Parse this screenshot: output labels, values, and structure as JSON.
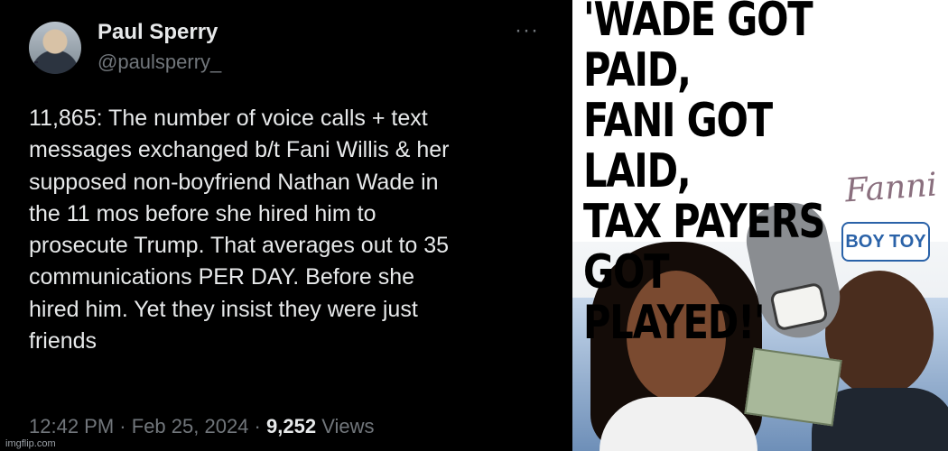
{
  "tweet": {
    "author_name": "Paul Sperry",
    "handle": "@paulsperry_",
    "more_icon": "ellipsis-icon",
    "text": "11,865: The number of voice calls + text\nmessages exchanged b/t Fani Willis & her\nsupposed non-boyfriend Nathan Wade in\nthe 11 mos before she hired him to\nprosecute Trump. That averages out to 35\ncommunications PER DAY. Before she\nhired him. Yet they insist they were just\nfriends",
    "time": "12:42 PM",
    "date": "Feb 25, 2024",
    "separator": "·",
    "views_count": "9,252",
    "views_label": "Views"
  },
  "watermark": "imgflip.com",
  "meme": {
    "headline": "'WADE GOT PAID,\nFANI GOT LAID,\nTAX PAYERS GOT\nPLAYED!'",
    "signature": "Fanni",
    "badge": "BOY TOY"
  },
  "colors": {
    "tweet_bg": "#000000",
    "primary_text": "#e7e9ea",
    "secondary_text": "#71767b",
    "badge_blue": "#2a62a8"
  }
}
